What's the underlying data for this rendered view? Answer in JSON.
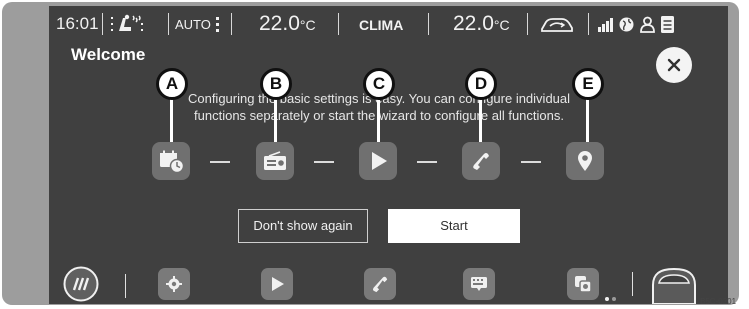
{
  "status_bar": {
    "time": "16:01",
    "auto_label": "AUTO",
    "left_temp": "22.0",
    "right_temp": "22.0",
    "temp_unit": "°C",
    "clima_label": "CLIMA"
  },
  "welcome": {
    "title": "Welcome",
    "intro_line1": "Configuring the basic settings is easy. You can configure individual",
    "intro_line2": "functions separately or start the wizard to configure all functions.",
    "steps": [
      {
        "callout": "A",
        "icon": "calendar-clock-icon"
      },
      {
        "callout": "B",
        "icon": "radio-icon"
      },
      {
        "callout": "C",
        "icon": "play-icon"
      },
      {
        "callout": "D",
        "icon": "phone-icon"
      },
      {
        "callout": "E",
        "icon": "location-pin-icon"
      }
    ],
    "dont_show_label": "Don't show again",
    "start_label": "Start"
  },
  "dock": {
    "items": [
      "menu-icon",
      "settings-icon",
      "play-icon",
      "phone-icon",
      "keyboard-icon",
      "app-icon",
      "car-icon"
    ],
    "page_dots": 2
  },
  "figure_ref": "B5C-0201",
  "colors": {
    "screen_bg": "#404040",
    "tile_bg": "#707070",
    "callout_border": "#101010",
    "bezel": "#9d9d9d"
  }
}
